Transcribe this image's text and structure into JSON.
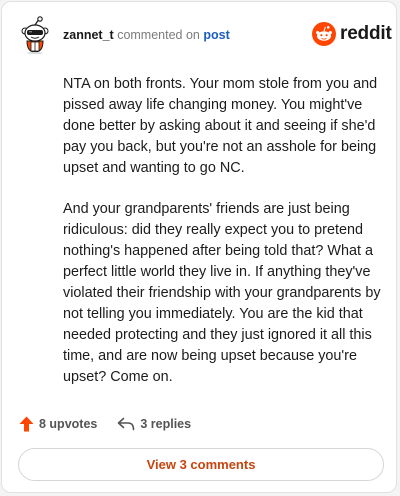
{
  "header": {
    "username": "zannet_t",
    "action_text": "commented on",
    "link_text": "post",
    "brand_name": "reddit",
    "brand_color": "#ff4500",
    "avatar_icon": "snoo-avatar-icon",
    "logo_icon": "reddit-logo-icon"
  },
  "comment": {
    "paragraphs": [
      "NTA on both fronts. Your mom stole from you and pissed away life changing money. You might've done better by asking about it and seeing if she'd pay you back, but you're not an asshole for being upset and wanting to go NC.",
      "And your grandparents' friends are just being ridiculous: did they really expect you to pretend nothing's happened after being told that? What a perfect little world they live in. If anything they've violated their friendship with your grandparents by not telling you immediately. You are the kid that needed protecting and they just ignored it all this time, and are now being upset because you're upset? Come on."
    ]
  },
  "actions": {
    "upvotes_label": "8 upvotes",
    "replies_label": "3 replies",
    "upvote_icon": "upvote-arrow-icon",
    "reply_icon": "reply-arrow-icon",
    "upvote_color": "#ff4500"
  },
  "footer": {
    "view_comments_label": "View 3 comments",
    "accent_color": "#c7450e"
  }
}
